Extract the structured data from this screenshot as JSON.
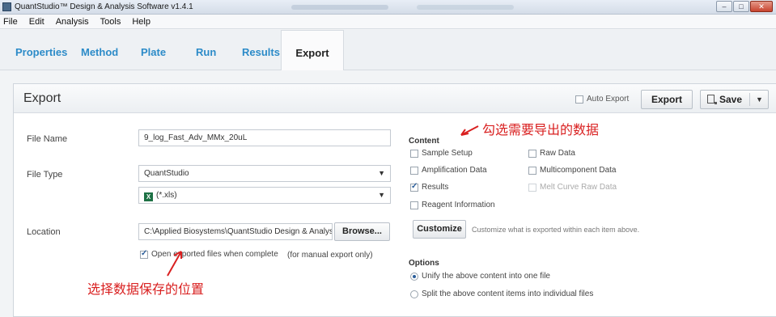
{
  "window": {
    "title": "QuantStudio™ Design & Analysis Software v1.4.1"
  },
  "menu": [
    "File",
    "Edit",
    "Analysis",
    "Tools",
    "Help"
  ],
  "tabs": [
    "Properties",
    "Method",
    "Plate",
    "Run",
    "Results",
    "Export"
  ],
  "active_tab": "Export",
  "export_panel": {
    "title": "Export",
    "auto_export_label": "Auto Export",
    "export_button": "Export",
    "save_button": "Save"
  },
  "form": {
    "file_name_label": "File Name",
    "file_name_value": "9_log_Fast_Adv_MMx_20uL",
    "file_type_label": "File Type",
    "file_type_value": "QuantStudio",
    "file_ext_value": "(*.xls)",
    "location_label": "Location",
    "location_value": "C:\\Applied Biosystems\\QuantStudio Design & Analysis Sc",
    "browse_button": "Browse...",
    "open_after_label": "Open exported files when complete",
    "manual_note": "(for manual export only)"
  },
  "content": {
    "title": "Content",
    "items": [
      {
        "label": "Sample Setup",
        "checked": false
      },
      {
        "label": "Raw Data",
        "checked": false
      },
      {
        "label": "Amplification Data",
        "checked": false
      },
      {
        "label": "Multicomponent Data",
        "checked": false
      },
      {
        "label": "Results",
        "checked": true
      },
      {
        "label": "Melt Curve Raw Data",
        "checked": false,
        "disabled": true
      },
      {
        "label": "Reagent Information",
        "checked": false
      }
    ],
    "customize_button": "Customize",
    "customize_note": "Customize what is exported within each item above."
  },
  "options": {
    "title": "Options",
    "unify": "Unify the above content into one file",
    "split": "Split the above content items into individual files",
    "selected": "unify"
  },
  "annotations": {
    "content_note": "勾选需要导出的数据",
    "location_note": "选择数据保存的位置",
    "color": "#d92020"
  }
}
